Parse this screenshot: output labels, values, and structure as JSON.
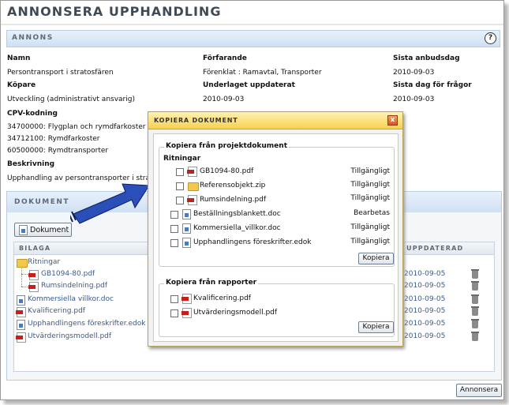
{
  "page": {
    "title": "ANNONSERA UPPHANDLING"
  },
  "annons": {
    "header": "ANNONS",
    "help_glyph": "?",
    "fields": [
      {
        "label": "Namn",
        "value": "Persontransport i stratosfären"
      },
      {
        "label": "Förfarande",
        "value": "Förenklat : Ramavtal, Transporter"
      },
      {
        "label": "Sista anbudsdag",
        "value": "2010-09-03"
      },
      {
        "label": "Köpare",
        "value": "Utveckling (administrativt ansvarig)"
      },
      {
        "label": "Underlaget uppdaterat",
        "value": "2010-09-03"
      },
      {
        "label": "Sista dag för frågor",
        "value": "2010-09-03"
      }
    ],
    "cpv_label": "CPV-kodning",
    "cpv_codes": [
      "34700000: Flygplan och rymdfarkoster",
      "34712100: Rymdfarkoster",
      "60500000: Rymdtransporter"
    ],
    "description_label": "Beskrivning",
    "description": "Upphandling av persontransporter i strato"
  },
  "dokument": {
    "header": "DOKUMENT",
    "button": "Dokument",
    "columns": {
      "bilaga": "BILAGA",
      "updated": "UPPDATERAD"
    },
    "rows": [
      {
        "name": "Ritningar",
        "icon": "folder-icon",
        "date": ""
      },
      {
        "name": "GB1094-80.pdf",
        "icon": "pdf-icon",
        "date": "2010-09-05"
      },
      {
        "name": "Rumsindelning.pdf",
        "icon": "pdf-icon",
        "date": "2010-09-05"
      },
      {
        "name": "Kommersiella villkor.doc",
        "icon": "doc-icon",
        "date": "2010-09-05"
      },
      {
        "name": "Kvalificering.pdf",
        "icon": "pdf-icon",
        "date": "2010-09-05"
      },
      {
        "name": "Upphandlingens föreskrifter.edok",
        "icon": "doc-icon",
        "date": "2010-09-05"
      },
      {
        "name": "Utvärderingsmodell.pdf",
        "icon": "pdf-icon",
        "date": "2010-09-05"
      }
    ]
  },
  "dialog": {
    "title": "KOPIERA DOKUMENT",
    "close_glyph": "x",
    "group1": {
      "legend": "Kopiera från projektdokument",
      "folder": "Ritningar",
      "items": [
        {
          "name": "GB1094-80.pdf",
          "status": "Tillgängligt",
          "icon": "pdf-icon"
        },
        {
          "name": "Referensobjekt.zip",
          "status": "Tillgängligt",
          "icon": "zip-icon"
        },
        {
          "name": "Rumsindelning.pdf",
          "status": "Tillgängligt",
          "icon": "pdf-icon"
        },
        {
          "name": "Beställningsblankett.doc",
          "status": "Bearbetas",
          "icon": "doc-icon"
        },
        {
          "name": "Kommersiella_villkor.doc",
          "status": "Tillgängligt",
          "icon": "doc-icon"
        },
        {
          "name": "Upphandlingens föreskrifter.edok",
          "status": "Tillgängligt",
          "icon": "doc-icon"
        }
      ],
      "button": "Kopiera"
    },
    "group2": {
      "legend": "Kopiera från rapporter",
      "items": [
        {
          "name": "Kvalificering.pdf",
          "icon": "pdf-icon"
        },
        {
          "name": "Utvärderingsmodell.pdf",
          "icon": "pdf-icon"
        }
      ],
      "button": "Kopiera"
    }
  },
  "footer": {
    "button": "Annonsera"
  },
  "colors": {
    "accent": "#2b4fb8",
    "section_blue": "#cfe0f2",
    "dialog_yellow": "#f7d14e",
    "link": "#3b5a86"
  }
}
